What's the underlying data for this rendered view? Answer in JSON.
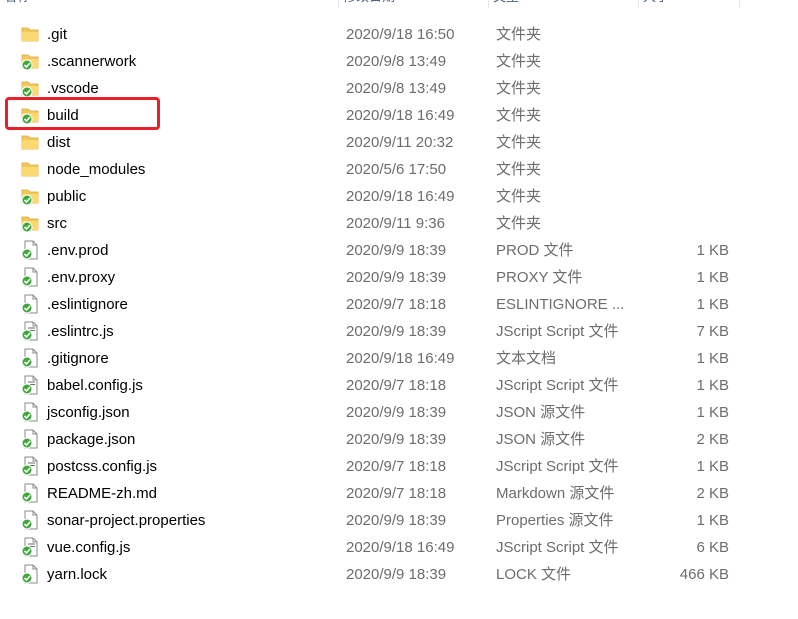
{
  "columns": {
    "name": "名称",
    "date": "修改日期",
    "type": "类型",
    "size": "大小"
  },
  "files": [
    {
      "name": ".git",
      "date": "2020/9/18 16:50",
      "type": "文件夹",
      "size": "",
      "icon": "folder-icon",
      "badge": false
    },
    {
      "name": ".scannerwork",
      "date": "2020/9/8 13:49",
      "type": "文件夹",
      "size": "",
      "icon": "folder-icon",
      "badge": true
    },
    {
      "name": ".vscode",
      "date": "2020/9/8 13:49",
      "type": "文件夹",
      "size": "",
      "icon": "folder-icon",
      "badge": true
    },
    {
      "name": "build",
      "date": "2020/9/18 16:49",
      "type": "文件夹",
      "size": "",
      "icon": "folder-icon",
      "badge": true
    },
    {
      "name": "dist",
      "date": "2020/9/11 20:32",
      "type": "文件夹",
      "size": "",
      "icon": "folder-icon",
      "badge": false
    },
    {
      "name": "node_modules",
      "date": "2020/5/6 17:50",
      "type": "文件夹",
      "size": "",
      "icon": "folder-icon",
      "badge": false
    },
    {
      "name": "public",
      "date": "2020/9/18 16:49",
      "type": "文件夹",
      "size": "",
      "icon": "folder-icon",
      "badge": true
    },
    {
      "name": "src",
      "date": "2020/9/11 9:36",
      "type": "文件夹",
      "size": "",
      "icon": "folder-icon",
      "badge": true
    },
    {
      "name": ".env.prod",
      "date": "2020/9/9 18:39",
      "type": "PROD 文件",
      "size": "1 KB",
      "icon": "file-icon",
      "badge": true
    },
    {
      "name": ".env.proxy",
      "date": "2020/9/9 18:39",
      "type": "PROXY 文件",
      "size": "1 KB",
      "icon": "file-icon",
      "badge": true
    },
    {
      "name": ".eslintignore",
      "date": "2020/9/7 18:18",
      "type": "ESLINTIGNORE ...",
      "size": "1 KB",
      "icon": "file-icon",
      "badge": true
    },
    {
      "name": ".eslintrc.js",
      "date": "2020/9/9 18:39",
      "type": "JScript Script 文件",
      "size": "7 KB",
      "icon": "script-file-icon",
      "badge": true
    },
    {
      "name": ".gitignore",
      "date": "2020/9/18 16:49",
      "type": "文本文档",
      "size": "1 KB",
      "icon": "file-icon",
      "badge": true
    },
    {
      "name": "babel.config.js",
      "date": "2020/9/7 18:18",
      "type": "JScript Script 文件",
      "size": "1 KB",
      "icon": "script-file-icon",
      "badge": true
    },
    {
      "name": "jsconfig.json",
      "date": "2020/9/9 18:39",
      "type": "JSON 源文件",
      "size": "1 KB",
      "icon": "file-icon",
      "badge": true
    },
    {
      "name": "package.json",
      "date": "2020/9/9 18:39",
      "type": "JSON 源文件",
      "size": "2 KB",
      "icon": "file-icon",
      "badge": true
    },
    {
      "name": "postcss.config.js",
      "date": "2020/9/7 18:18",
      "type": "JScript Script 文件",
      "size": "1 KB",
      "icon": "script-file-icon",
      "badge": true
    },
    {
      "name": "README-zh.md",
      "date": "2020/9/7 18:18",
      "type": "Markdown 源文件",
      "size": "2 KB",
      "icon": "file-icon",
      "badge": true
    },
    {
      "name": "sonar-project.properties",
      "date": "2020/9/9 18:39",
      "type": "Properties 源文件",
      "size": "1 KB",
      "icon": "file-icon",
      "badge": true
    },
    {
      "name": "vue.config.js",
      "date": "2020/9/18 16:49",
      "type": "JScript Script 文件",
      "size": "6 KB",
      "icon": "script-file-icon",
      "badge": true
    },
    {
      "name": "yarn.lock",
      "date": "2020/9/9 18:39",
      "type": "LOCK 文件",
      "size": "466 KB",
      "icon": "file-icon",
      "badge": true
    }
  ],
  "highlight": {
    "target": "build",
    "color": "#e8202a"
  },
  "colors": {
    "folder": "#f4c75a",
    "badge": "#3fa83a"
  }
}
